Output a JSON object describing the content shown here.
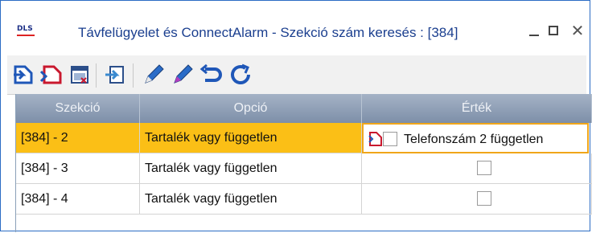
{
  "window": {
    "title": "Távfelügyelet és ConnectAlarm - Szekció szám keresés : [384]",
    "logo_text": "DLS",
    "minimize_label": "_",
    "maximize_label": "",
    "close_label": "✕"
  },
  "toolbar": {
    "buttons": [
      {
        "icon": "import-icon"
      },
      {
        "icon": "send-icon"
      },
      {
        "icon": "table-clear-icon"
      },
      {
        "icon": "transfer-icon"
      },
      {
        "icon": "edit-pen-icon"
      },
      {
        "icon": "edit-pen-purple-icon"
      },
      {
        "icon": "undo-icon"
      },
      {
        "icon": "refresh-icon"
      }
    ]
  },
  "grid": {
    "headers": [
      "Szekció",
      "Opció",
      "Érték"
    ],
    "rows": [
      {
        "section": "[384] - 2",
        "option": "Tartalék vagy független",
        "value_label": "Telefonszám 2 független",
        "checked": false,
        "selected": true
      },
      {
        "section": "[384] - 3",
        "option": "Tartalék vagy független",
        "value_label": "",
        "checked": false,
        "selected": false
      },
      {
        "section": "[384] - 4",
        "option": "Tartalék vagy független",
        "value_label": "",
        "checked": false,
        "selected": false
      }
    ]
  },
  "colors": {
    "title_text": "#1b3f8f",
    "header_bg": "#8d9db3",
    "selected_row": "#fbbf16",
    "selected_cell_border": "#f0a619"
  }
}
